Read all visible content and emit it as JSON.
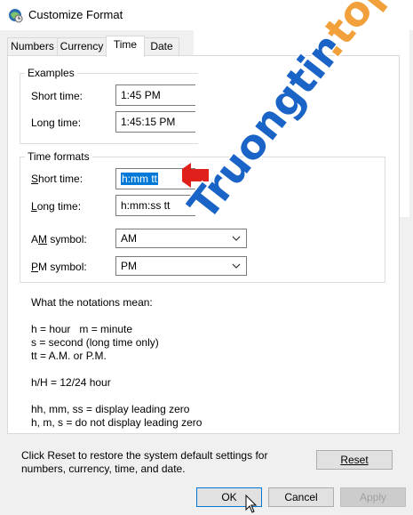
{
  "window": {
    "title": "Customize Format"
  },
  "tabs": [
    {
      "label": "Numbers"
    },
    {
      "label": "Currency"
    },
    {
      "label": "Time"
    },
    {
      "label": "Date"
    }
  ],
  "examples": {
    "group_label": "Examples",
    "short_time_label": "Short time:",
    "short_time_value": "1:45 PM",
    "long_time_label": "Long time:",
    "long_time_value": "1:45:15 PM"
  },
  "time_formats": {
    "group_label": "Time formats",
    "short_time_label_u": "S",
    "short_time_label_rest": "hort time:",
    "short_time_value": "h:mm tt",
    "long_time_label_u": "L",
    "long_time_label_rest": "ong time:",
    "long_time_value": "h:mm:ss tt",
    "am_label_pre": "A",
    "am_label_u": "M",
    "am_label_rest": " symbol:",
    "am_value": "AM",
    "pm_label_u": "P",
    "pm_label_rest": "M symbol:",
    "pm_value": "PM"
  },
  "notations": {
    "heading": "What the notations mean:",
    "lines": [
      "h = hour   m = minute",
      "s = second (long time only)",
      "tt = A.M. or P.M.",
      "h/H = 12/24 hour",
      "hh, mm, ss = display leading zero",
      "h, m, s = do not display leading zero"
    ]
  },
  "reset": {
    "hint_line1": "Click Reset to restore the system default settings for",
    "hint_line2": "numbers, currency, time, and date.",
    "button_label": "Reset"
  },
  "footer": {
    "ok_label": "OK",
    "cancel_label": "Cancel",
    "apply_label": "Apply"
  },
  "watermark": {
    "text": "Truongtin",
    "suffix": ".top"
  },
  "colors": {
    "selection": "#0078d7",
    "watermark_blue": "#1a63c7",
    "watermark_orange": "#f2a03b",
    "arrow_red": "#e0211b"
  }
}
